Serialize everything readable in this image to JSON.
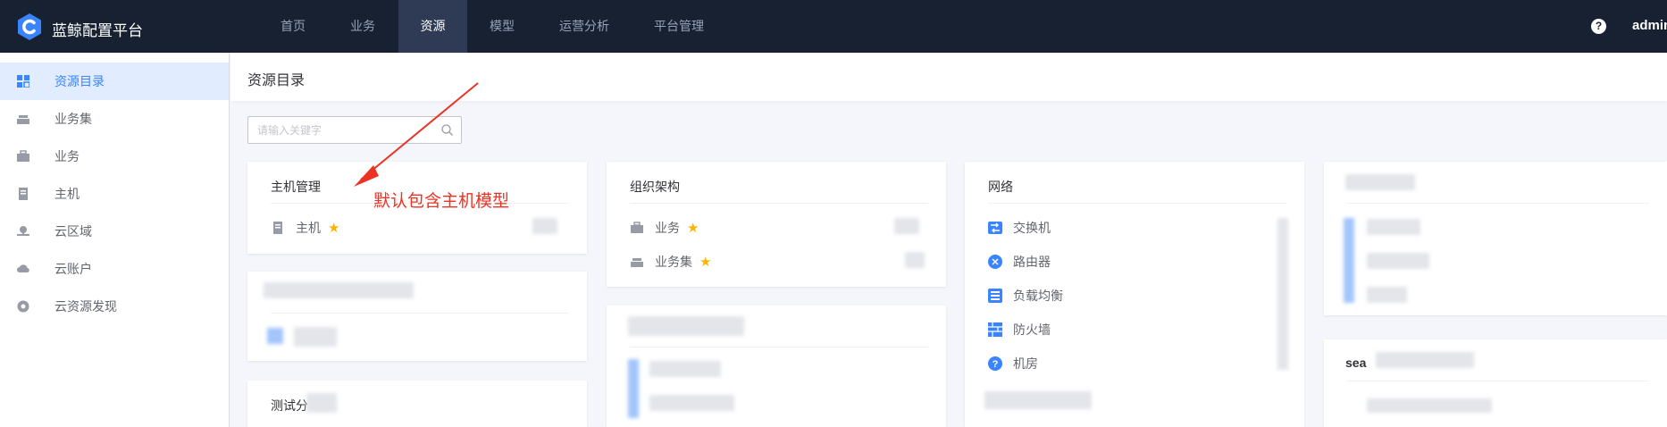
{
  "app": {
    "name": "蓝鲸配置平台",
    "user": "admin"
  },
  "nav": [
    {
      "label": "首页",
      "active": false
    },
    {
      "label": "业务",
      "active": false
    },
    {
      "label": "资源",
      "active": true
    },
    {
      "label": "模型",
      "active": false
    },
    {
      "label": "运营分析",
      "active": false
    },
    {
      "label": "平台管理",
      "active": false
    }
  ],
  "sidebar": {
    "items": [
      {
        "label": "资源目录",
        "icon": "grid-icon",
        "active": true
      },
      {
        "label": "业务集",
        "icon": "business-set-icon",
        "active": false
      },
      {
        "label": "业务",
        "icon": "briefcase-icon",
        "active": false
      },
      {
        "label": "主机",
        "icon": "host-icon",
        "active": false
      },
      {
        "label": "云区域",
        "icon": "cloud-area-icon",
        "active": false
      },
      {
        "label": "云账户",
        "icon": "cloud-account-icon",
        "active": false
      },
      {
        "label": "云资源发现",
        "icon": "cloud-discovery-icon",
        "active": false
      }
    ]
  },
  "page": {
    "title": "资源目录"
  },
  "search": {
    "placeholder": "请输入关键字"
  },
  "annotation": {
    "text": "默认包含主机模型",
    "color": "#ea3323"
  },
  "cards": {
    "host_management": {
      "title": "主机管理",
      "items": [
        {
          "label": "主机",
          "starred": true
        }
      ]
    },
    "organization": {
      "title": "组织架构",
      "items": [
        {
          "label": "业务",
          "starred": true
        },
        {
          "label": "业务集",
          "starred": true
        }
      ]
    },
    "network": {
      "title": "网络",
      "items": [
        {
          "label": "交换机"
        },
        {
          "label": "路由器"
        },
        {
          "label": "负载均衡"
        },
        {
          "label": "防火墙"
        },
        {
          "label": "机房"
        }
      ]
    },
    "test": {
      "title": "测试分"
    },
    "partial": {
      "title": "sea"
    }
  },
  "colors": {
    "topbar": "#182132",
    "active_nav": "#2f3b55",
    "accent": "#3a84ff",
    "star": "#ffb400"
  }
}
